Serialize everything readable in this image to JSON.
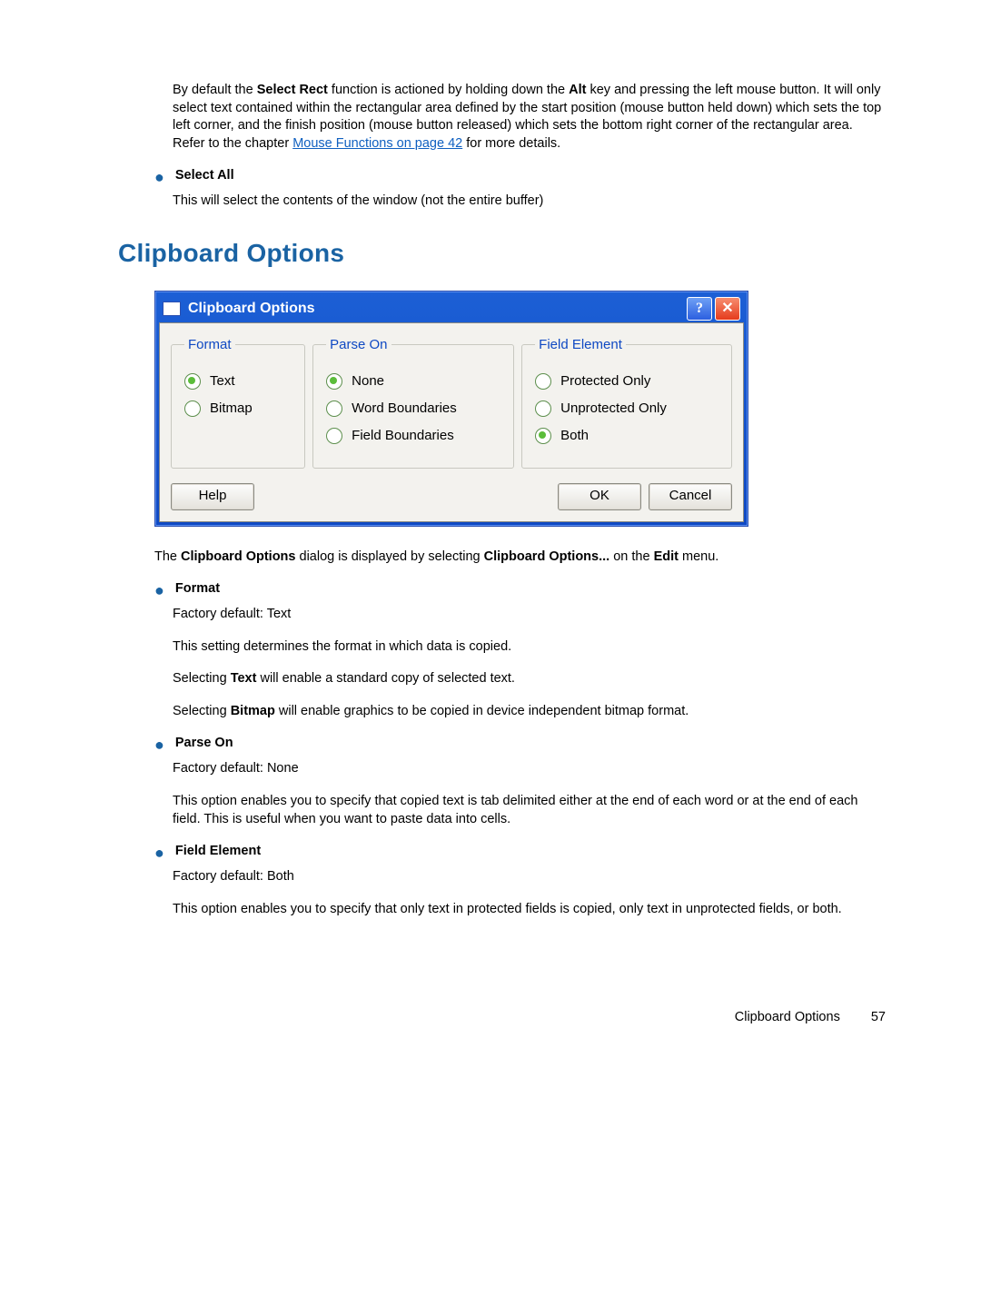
{
  "intro_para": {
    "pre": "By default the ",
    "bold1": "Select Rect",
    "mid1": " function is actioned by holding down the ",
    "bold2": "Alt",
    "post": " key and pressing the left mouse button. It will only select text contained within the rectangular area defined by the start position (mouse button held down) which sets the top left corner, and the finish position (mouse button released) which sets the bottom right corner of the rectangular area. Refer to the chapter ",
    "link": "Mouse Functions on page 42",
    "tail": " for more details."
  },
  "select_all": {
    "label": "Select All",
    "desc": "This will select the contents of the window (not the entire buffer)"
  },
  "section_title": "Clipboard Options",
  "dialog": {
    "title": "Clipboard Options",
    "groups": {
      "format": {
        "legend": "Format",
        "options": [
          {
            "label": "Text",
            "selected": true
          },
          {
            "label": "Bitmap",
            "selected": false
          }
        ]
      },
      "parse_on": {
        "legend": "Parse On",
        "options": [
          {
            "label": "None",
            "selected": true
          },
          {
            "label": "Word Boundaries",
            "selected": false
          },
          {
            "label": "Field Boundaries",
            "selected": false
          }
        ]
      },
      "field_element": {
        "legend": "Field Element",
        "options": [
          {
            "label": "Protected Only",
            "selected": false
          },
          {
            "label": "Unprotected Only",
            "selected": false
          },
          {
            "label": "Both",
            "selected": true
          }
        ]
      }
    },
    "buttons": {
      "help": "Help",
      "ok": "OK",
      "cancel": "Cancel"
    }
  },
  "intro2": {
    "pre": "The ",
    "bold1": "Clipboard Options",
    "mid": " dialog is displayed by selecting ",
    "bold2": "Clipboard Options...",
    "mid2": " on the ",
    "bold3": "Edit",
    "post": " menu."
  },
  "format_section": {
    "label": "Format",
    "p1": "Factory default: Text",
    "p2": "This setting determines the format in which data is copied.",
    "p3a": "Selecting ",
    "p3b": "Text",
    "p3c": " will enable a standard copy of selected text.",
    "p4a": "Selecting ",
    "p4b": "Bitmap",
    "p4c": " will enable graphics to be copied in device independent bitmap format."
  },
  "parse_section": {
    "label": "Parse On",
    "p1": "Factory default: None",
    "p2": "This option enables you to specify that copied text is tab delimited either at the end of each word or at the end of each field. This is useful when you want to paste data into cells."
  },
  "field_section": {
    "label": "Field Element",
    "p1": "Factory default: Both",
    "p2": "This option enables you to specify that only text in protected fields is copied, only text in unprotected fields, or both."
  },
  "footer": {
    "label": "Clipboard Options",
    "page": "57"
  }
}
